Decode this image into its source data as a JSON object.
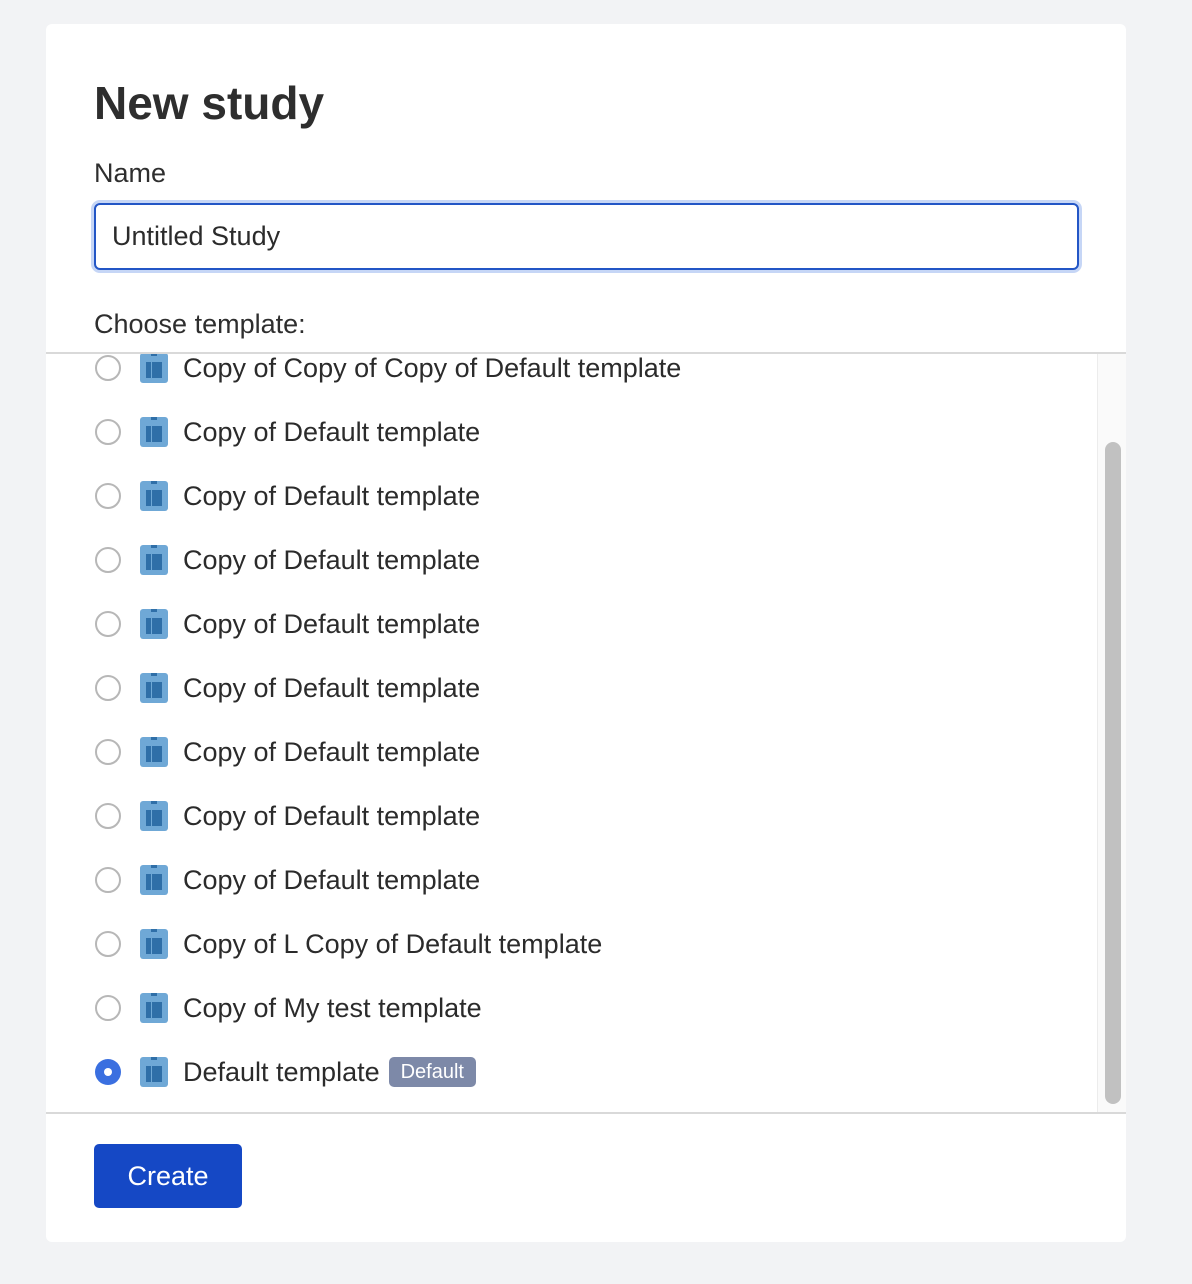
{
  "dialog": {
    "title": "New study",
    "name_label": "Name",
    "name_value": "Untitled Study",
    "template_label": "Choose template:",
    "create_label": "Create"
  },
  "templates": [
    {
      "label": "Copy of Copy of Copy of Default template",
      "selected": false,
      "badge": ""
    },
    {
      "label": "Copy of Default template",
      "selected": false,
      "badge": ""
    },
    {
      "label": "Copy of Default template",
      "selected": false,
      "badge": ""
    },
    {
      "label": "Copy of Default template",
      "selected": false,
      "badge": ""
    },
    {
      "label": "Copy of Default template",
      "selected": false,
      "badge": ""
    },
    {
      "label": "Copy of Default template",
      "selected": false,
      "badge": ""
    },
    {
      "label": "Copy of Default template",
      "selected": false,
      "badge": ""
    },
    {
      "label": "Copy of Default template",
      "selected": false,
      "badge": ""
    },
    {
      "label": "Copy of Default template",
      "selected": false,
      "badge": ""
    },
    {
      "label": "Copy of L Copy of Default template",
      "selected": false,
      "badge": ""
    },
    {
      "label": "Copy of My test template",
      "selected": false,
      "badge": ""
    },
    {
      "label": "Default template",
      "selected": true,
      "badge": "Default"
    }
  ],
  "icons": {
    "template_icon": "template-icon",
    "template_icon_color": "#6fa8d6",
    "template_icon_accent": "#2f6fa8"
  },
  "colors": {
    "primary": "#1548c5",
    "radio_selected": "#3a6fe0",
    "badge_bg": "#7d89a8"
  }
}
